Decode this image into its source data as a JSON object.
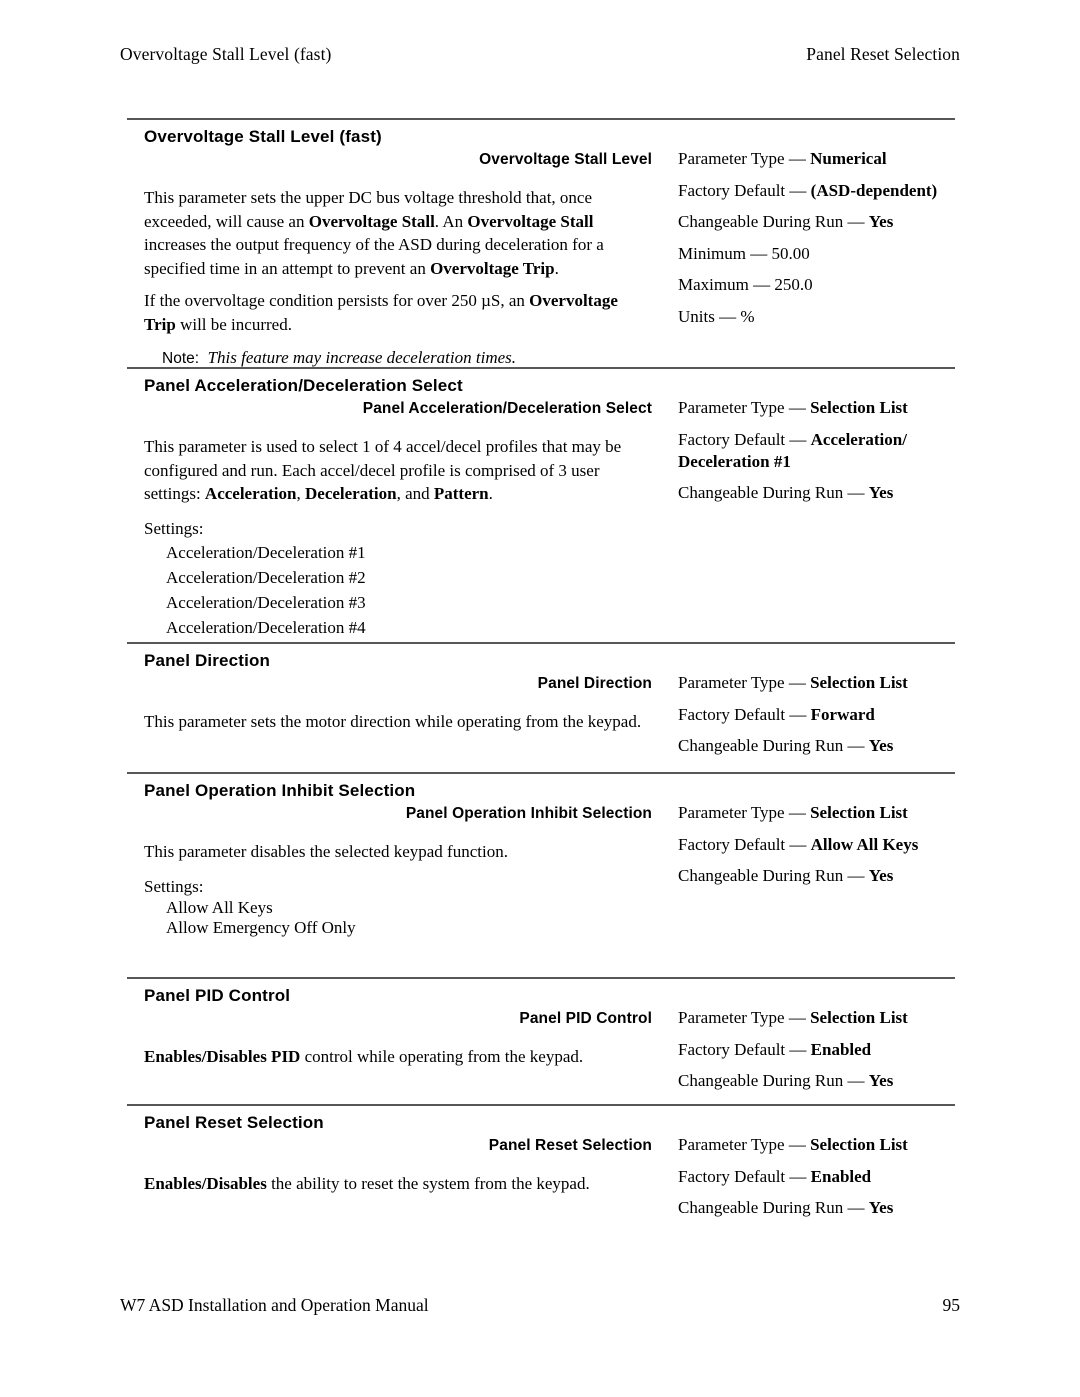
{
  "header": {
    "left": "Overvoltage Stall Level (fast)",
    "right": "Panel Reset Selection"
  },
  "footer": {
    "manual_title": "W7 ASD Installation and Operation Manual",
    "page_number": "95"
  },
  "sections": [
    {
      "title": "Overvoltage Stall Level (fast)",
      "subtitle": "Overvoltage Stall Level",
      "paragraphs": [
        [
          {
            "t": "This parameter sets the upper DC bus voltage threshold that, once exceeded, will cause an ",
            "s": "n"
          },
          {
            "t": "Overvoltage Stall",
            "s": "b"
          },
          {
            "t": ". An ",
            "s": "n"
          },
          {
            "t": "Overvoltage Stall",
            "s": "b"
          },
          {
            "t": " increases the output frequency of the ASD during deceleration for a specified time in an attempt to prevent an ",
            "s": "n"
          },
          {
            "t": "Overvoltage Trip",
            "s": "b"
          },
          {
            "t": ".",
            "s": "n"
          }
        ],
        [
          {
            "t": "If the overvoltage condition persists for over 250 µS, an ",
            "s": "n"
          },
          {
            "t": "Overvoltage Trip",
            "s": "b"
          },
          {
            "t": " will be incurred.",
            "s": "n"
          }
        ]
      ],
      "note": {
        "label": "Note:",
        "text": "This feature may increase deceleration times."
      },
      "settings_label": "",
      "settings": [],
      "params": [
        {
          "label": "Parameter Type — ",
          "value": "Numerical",
          "bold_value": true
        },
        {
          "label": "Factory Default — ",
          "value": "(ASD-dependent)",
          "bold_value": true
        },
        {
          "label": "Changeable During Run — ",
          "value": "Yes",
          "bold_value": true
        },
        {
          "label": "Minimum — ",
          "value": "50.00",
          "bold_value": false
        },
        {
          "label": "Maximum — ",
          "value": "250.0",
          "bold_value": false
        },
        {
          "label": "Units — ",
          "value": "%",
          "bold_value": false
        }
      ]
    },
    {
      "title": "Panel Acceleration/Deceleration Select",
      "subtitle": "Panel Acceleration/Deceleration Select",
      "paragraphs": [
        [
          {
            "t": "This parameter is used to select 1 of 4 accel/decel profiles that may be configured and run. Each accel/decel profile is comprised of 3 user settings: ",
            "s": "n"
          },
          {
            "t": "Acceleration",
            "s": "b"
          },
          {
            "t": ", ",
            "s": "n"
          },
          {
            "t": "Deceleration",
            "s": "b"
          },
          {
            "t": ", and ",
            "s": "n"
          },
          {
            "t": "Pattern",
            "s": "b"
          },
          {
            "t": ".",
            "s": "n"
          }
        ]
      ],
      "note": null,
      "settings_label": "Settings:",
      "settings": [
        "Acceleration/Deceleration #1",
        "Acceleration/Deceleration #2",
        "Acceleration/Deceleration #3",
        "Acceleration/Deceleration #4"
      ],
      "params": [
        {
          "label": "Parameter Type — ",
          "value": "Selection List",
          "bold_value": true
        },
        {
          "label": "Factory Default — ",
          "value": "Acceleration/ Deceleration #1",
          "bold_value": true
        },
        {
          "label": "Changeable During Run — ",
          "value": "Yes",
          "bold_value": true
        }
      ]
    },
    {
      "title": "Panel Direction",
      "subtitle": "Panel Direction",
      "paragraphs": [
        [
          {
            "t": "This parameter sets the motor direction while operating from the keypad.",
            "s": "n"
          }
        ]
      ],
      "note": null,
      "settings_label": "",
      "settings": [],
      "params": [
        {
          "label": "Parameter Type — ",
          "value": "Selection List",
          "bold_value": true
        },
        {
          "label": "Factory Default — ",
          "value": "Forward",
          "bold_value": true
        },
        {
          "label": "Changeable During Run — ",
          "value": "Yes",
          "bold_value": true
        }
      ]
    },
    {
      "title": "Panel Operation Inhibit Selection",
      "subtitle": "Panel Operation Inhibit Selection",
      "paragraphs": [
        [
          {
            "t": "This parameter disables the selected keypad function.",
            "s": "n"
          }
        ]
      ],
      "note": null,
      "settings_label": "Settings:",
      "settings": [
        "Allow All Keys",
        "Allow Emergency Off Only"
      ],
      "params": [
        {
          "label": "Parameter Type — ",
          "value": "Selection List",
          "bold_value": true
        },
        {
          "label": "Factory Default — ",
          "value": "Allow All Keys",
          "bold_value": true
        },
        {
          "label": "Changeable During Run — ",
          "value": "Yes",
          "bold_value": true
        }
      ]
    },
    {
      "title": "Panel PID Control",
      "subtitle": "Panel PID Control",
      "paragraphs": [
        [
          {
            "t": "Enables/Disables PID",
            "s": "b"
          },
          {
            "t": " control while operating from the keypad.",
            "s": "n"
          }
        ]
      ],
      "note": null,
      "settings_label": "",
      "settings": [],
      "params": [
        {
          "label": "Parameter Type — ",
          "value": "Selection List",
          "bold_value": true
        },
        {
          "label": "Factory Default — ",
          "value": "Enabled",
          "bold_value": true
        },
        {
          "label": "Changeable During Run — ",
          "value": "Yes",
          "bold_value": true
        }
      ]
    },
    {
      "title": "Panel Reset Selection",
      "subtitle": "Panel Reset Selection",
      "paragraphs": [
        [
          {
            "t": "Enables/Disables",
            "s": "b"
          },
          {
            "t": " the ability to reset the system from the keypad.",
            "s": "n"
          }
        ]
      ],
      "note": null,
      "settings_label": "",
      "settings": [],
      "params": [
        {
          "label": "Parameter Type — ",
          "value": "Selection List",
          "bold_value": true
        },
        {
          "label": "Factory Default — ",
          "value": "Enabled",
          "bold_value": true
        },
        {
          "label": "Changeable During Run — ",
          "value": "Yes",
          "bold_value": true
        }
      ]
    }
  ],
  "layout": {
    "rule_tops": [
      118,
      367,
      642,
      772,
      977,
      1104
    ],
    "section_tops": [
      126,
      375,
      650,
      780,
      985,
      1112
    ],
    "subtitle_offsets": [
      36,
      36,
      36,
      36,
      36,
      36
    ]
  }
}
